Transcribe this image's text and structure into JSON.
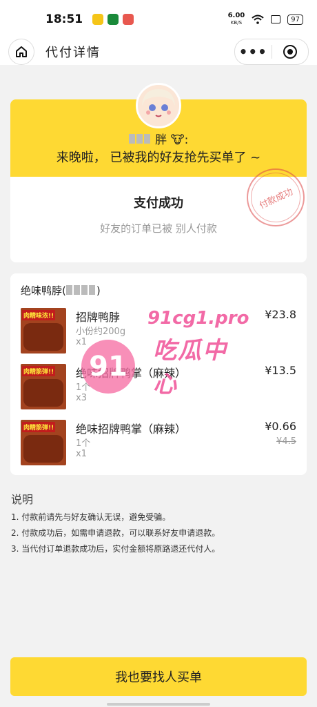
{
  "status_bar": {
    "time": "18:51",
    "net_speed": "6.00",
    "net_unit": "KB/S",
    "battery": "97",
    "app_colors": [
      "#f5c518",
      "#1a8a3a",
      "#e8584f"
    ]
  },
  "nav": {
    "title": "代付详情",
    "home_icon": "home-icon",
    "more_icon": "more-dots-icon",
    "close_icon": "target-icon",
    "more_glyph": "•••"
  },
  "header_card": {
    "friend_name": "胖",
    "message": "来晚啦， 已被我的好友抢先买单了 ~",
    "accent_color": "#fed933"
  },
  "status_card": {
    "title": "支付成功",
    "subtitle": "好友的订单已被 别人付款",
    "stamp_text": "付款成功"
  },
  "order": {
    "shop_name": "绝味鸭脖(",
    "items": [
      {
        "tag": "肉精味浓!!",
        "name": "招牌鸭脖",
        "spec": "小份约200g",
        "qty": "x1",
        "price": "¥23.8",
        "orig_price": ""
      },
      {
        "tag": "肉精筋弹!!",
        "name": "绝味招牌鸭掌（麻辣）",
        "spec": "1个",
        "qty": "x3",
        "price": "¥13.5",
        "orig_price": ""
      },
      {
        "tag": "肉精筋弹!!",
        "name": "绝味招牌鸭掌（麻辣）",
        "spec": "1个",
        "qty": "x1",
        "price": "¥0.66",
        "orig_price": "¥4.5"
      }
    ]
  },
  "watermark": {
    "badge": "91",
    "domain": "91cg1.pro",
    "name": "吃瓜中心"
  },
  "notes": {
    "title": "说明",
    "lines": [
      "1. 付款前请先与好友确认无误，避免受骗。",
      "2. 付款成功后，如需申请退款，可以联系好友申请退款。",
      "3. 当代付订单退款成功后，实付金额将原路退还代付人。"
    ]
  },
  "action": {
    "button_label": "我也要找人买单"
  }
}
